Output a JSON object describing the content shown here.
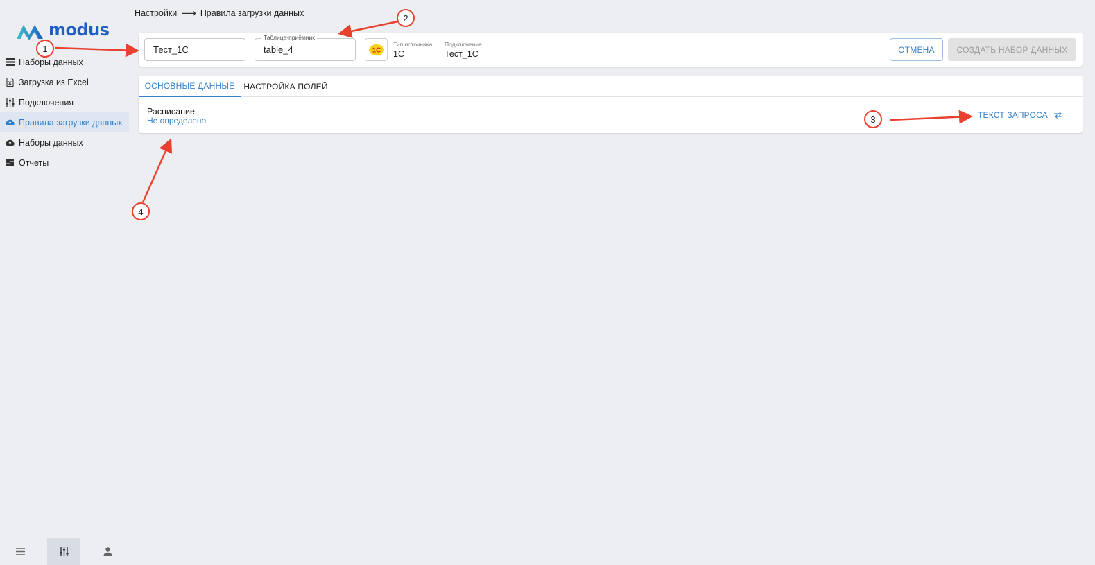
{
  "app": {
    "logo_text": "modus",
    "brand_color": "#1e5fc4",
    "accent_color": "#3a82c8"
  },
  "sidebar": {
    "items": [
      {
        "label": "Наборы данных",
        "icon": "list-icon",
        "active": false
      },
      {
        "label": "Загрузка из Excel",
        "icon": "excel-file-icon",
        "active": false
      },
      {
        "label": "Подключения",
        "icon": "sliders-icon",
        "active": false
      },
      {
        "label": "Правила загрузки данных",
        "icon": "cloud-upload-icon",
        "active": true
      },
      {
        "label": "Наборы данных",
        "icon": "cloud-icon",
        "active": false
      },
      {
        "label": "Отчеты",
        "icon": "dashboard-icon",
        "active": false
      }
    ],
    "bottom": [
      {
        "icon": "menu-icon",
        "active": false
      },
      {
        "icon": "sliders-icon",
        "active": true
      },
      {
        "icon": "user-icon",
        "active": false
      }
    ]
  },
  "breadcrumb": {
    "parent": "Настройки",
    "separator": "⟶",
    "current": "Правила загрузки данных"
  },
  "header": {
    "name_value": "Тест_1С",
    "target_table_label": "Таблица-приёмник",
    "target_table_value": "table_4",
    "source_logo_text": "1С",
    "source_type_label": "Тип источника",
    "source_type_value": "1С",
    "connection_label": "Подключение",
    "connection_value": "Тест_1С",
    "cancel_label": "ОТМЕНА",
    "create_label": "СОЗДАТЬ НАБОР ДАННЫХ"
  },
  "content": {
    "tabs": [
      {
        "label": "ОСНОВНЫЕ ДАННЫЕ",
        "active": true
      },
      {
        "label": "НАСТРОЙКА ПОЛЕЙ",
        "active": false
      }
    ],
    "schedule_label": "Расписание",
    "schedule_value": "Не определено",
    "query_text_label": "ТЕКСТ ЗАПРОСА"
  },
  "annotations": {
    "color": "#e8412f",
    "markers": [
      "1",
      "2",
      "3",
      "4"
    ]
  }
}
